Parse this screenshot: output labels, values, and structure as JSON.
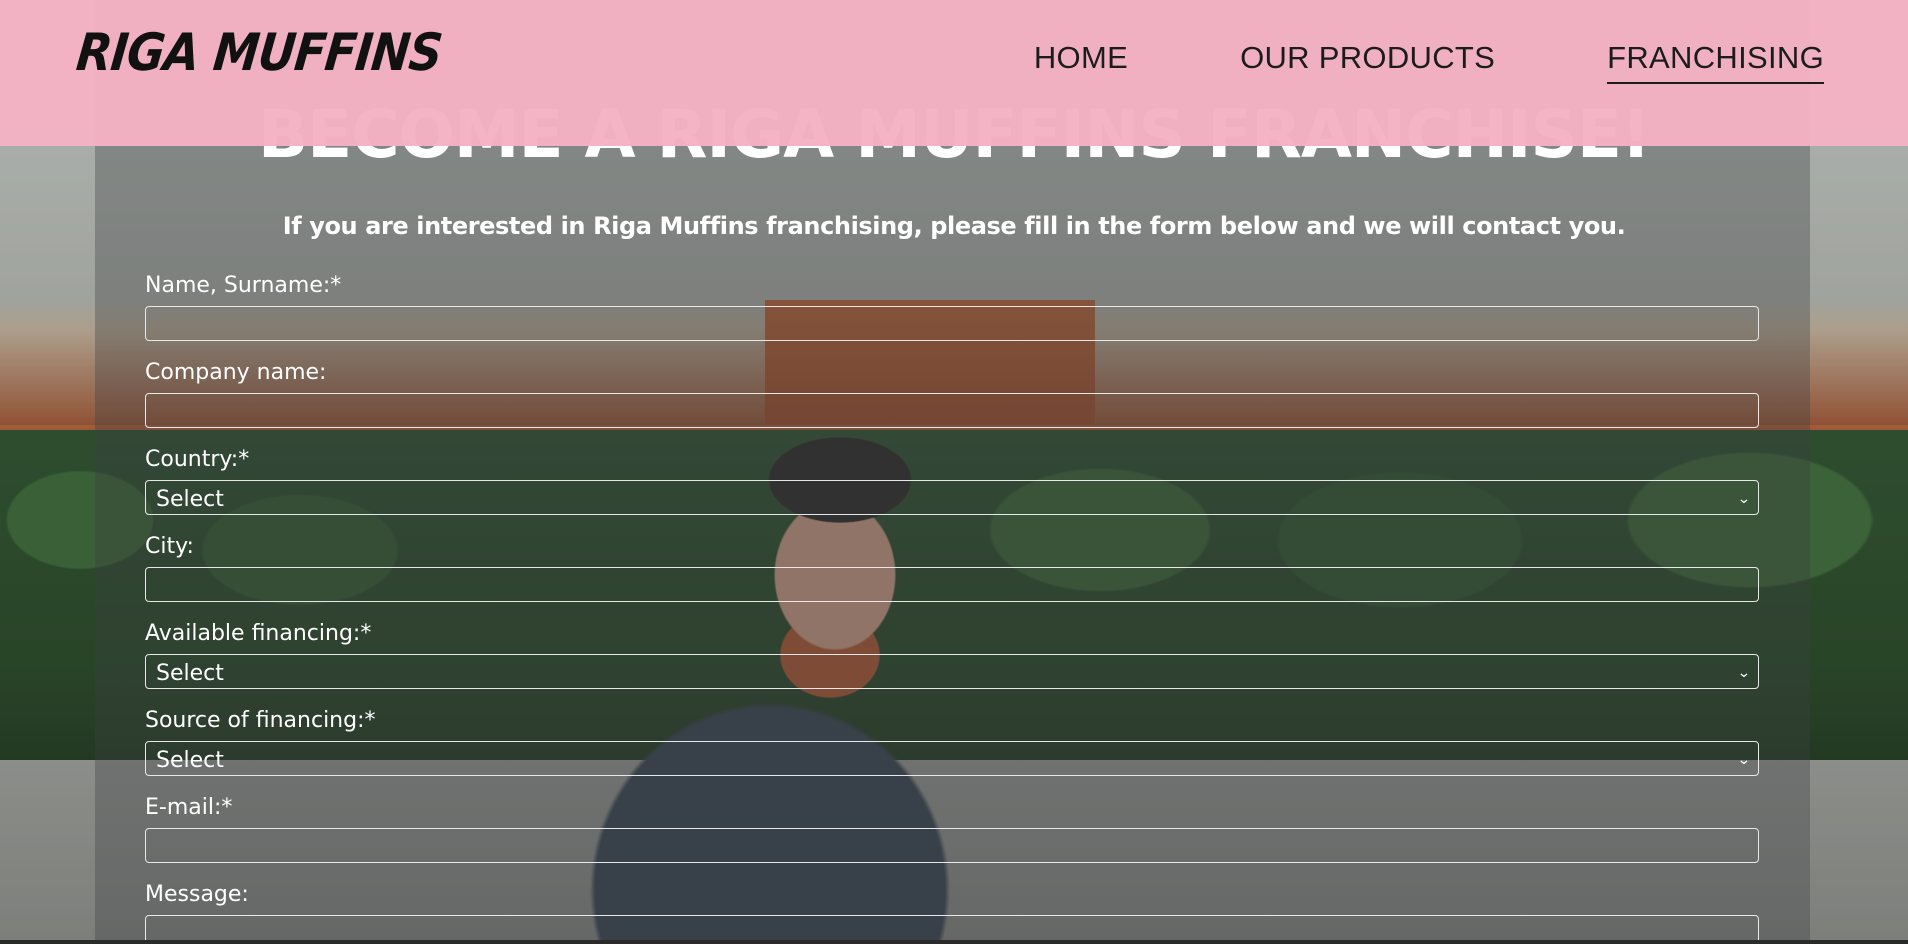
{
  "brand": {
    "logo_text": "RIGA MUFFINS",
    "header_color": "#f4b2c4"
  },
  "nav": {
    "items": [
      {
        "label": "HOME",
        "active": false
      },
      {
        "label": "OUR PRODUCTS",
        "active": false
      },
      {
        "label": "FRANCHISING",
        "active": true
      }
    ]
  },
  "hero": {
    "title": "BECOME A RIGA MUFFINS FRANCHISE!",
    "subtitle": "If you are interested in Riga Muffins franchising, please fill in the form below and we will contact you."
  },
  "form": {
    "name": {
      "label": "Name, Surname:*",
      "value": ""
    },
    "company": {
      "label": "Company name:",
      "value": ""
    },
    "country": {
      "label": "Country:*",
      "selected": "Select"
    },
    "city": {
      "label": "City:",
      "value": ""
    },
    "available_financing": {
      "label": "Available financing:*",
      "selected": "Select"
    },
    "source_financing": {
      "label": "Source of financing:*",
      "selected": "Select"
    },
    "email": {
      "label": "E-mail:*",
      "value": ""
    },
    "message": {
      "label": "Message:",
      "value": ""
    }
  },
  "icons": {
    "select_chevron": "chevron-down-icon"
  }
}
